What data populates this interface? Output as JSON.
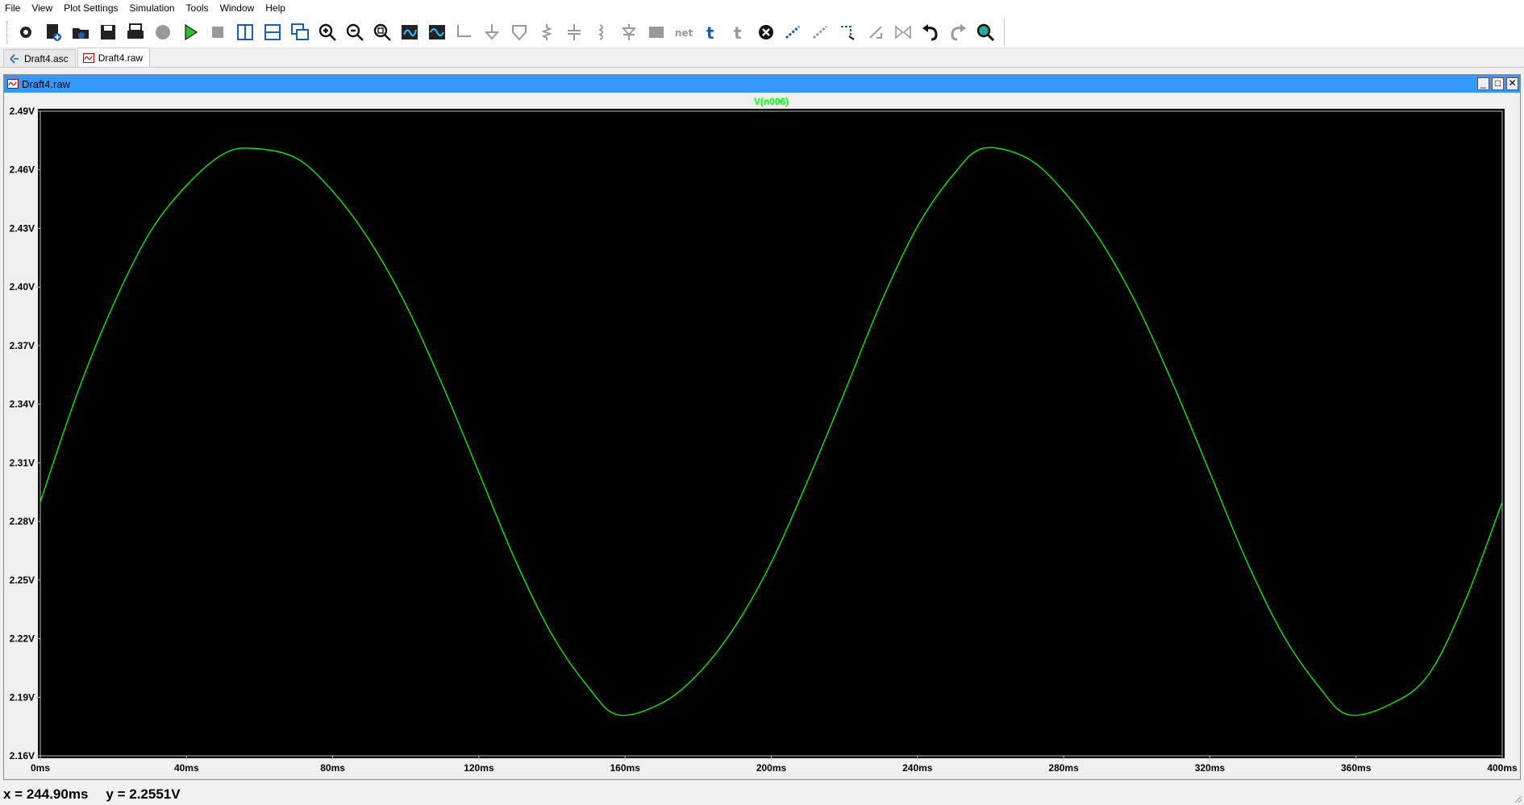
{
  "menu": [
    "File",
    "View",
    "Plot Settings",
    "Simulation",
    "Tools",
    "Window",
    "Help"
  ],
  "toolbar_icons": [
    "control-panel-icon",
    "new-schematic-icon",
    "open-icon",
    "save-icon",
    "print-icon",
    "halt-icon",
    "run-icon",
    "stop-icon",
    "tile-vertical-icon",
    "tile-horizontal-icon",
    "cascade-icon",
    "zoom-in-icon",
    "zoom-out-icon",
    "zoom-fit-icon",
    "autorange-icon",
    "waveform-icon",
    "wire-icon",
    "ground-icon",
    "label-net-icon",
    "resistor-icon",
    "capacitor-icon",
    "inductor-icon",
    "diode-icon",
    "component-icon",
    "net-label-icon",
    "text-icon",
    "spice-directive-icon",
    "delete-icon",
    "duplicate-icon",
    "move-icon",
    "drag-icon",
    "rotate-icon",
    "mirror-icon",
    "undo-icon",
    "redo-icon",
    "find-icon"
  ],
  "tabs": [
    {
      "label": "Draft4.asc",
      "icon": "schematic-icon"
    },
    {
      "label": "Draft4.raw",
      "icon": "waveform-icon"
    }
  ],
  "window": {
    "title": "Draft4.raw",
    "minimize": "_",
    "maximize": "□",
    "close": "✕"
  },
  "status": {
    "x": "x = 244.90ms",
    "y": "y = 2.2551V"
  },
  "colors": {
    "trace": "#00ff00",
    "background": "#000000",
    "axis": "#c0c0c0",
    "tick_label": "#000000",
    "titlebar": "#3399ff"
  },
  "chart_data": {
    "type": "line",
    "title": "V(n006)",
    "xlabel": "",
    "ylabel": "",
    "xlim": [
      0,
      400
    ],
    "ylim": [
      2.16,
      2.49
    ],
    "x_ticks": [
      "0ms",
      "40ms",
      "80ms",
      "120ms",
      "160ms",
      "200ms",
      "240ms",
      "280ms",
      "320ms",
      "360ms",
      "400ms"
    ],
    "y_ticks": [
      "2.49V",
      "2.46V",
      "2.43V",
      "2.40V",
      "2.37V",
      "2.34V",
      "2.31V",
      "2.28V",
      "2.25V",
      "2.22V",
      "2.19V",
      "2.16V"
    ],
    "grid": false,
    "series": [
      {
        "name": "V(n006)",
        "x_unit": "ms",
        "y_unit": "V",
        "x": [
          0,
          10,
          20,
          30,
          40,
          50,
          58,
          70,
          80,
          90,
          100,
          110,
          120,
          130,
          140,
          150,
          158,
          170,
          180,
          190,
          200,
          210,
          220,
          230,
          240,
          250,
          258,
          270,
          280,
          290,
          300,
          310,
          320,
          330,
          340,
          350,
          358,
          370,
          380,
          390,
          400
        ],
        "y": [
          2.29,
          2.345,
          2.391,
          2.428,
          2.452,
          2.468,
          2.471,
          2.466,
          2.449,
          2.424,
          2.391,
          2.35,
          2.305,
          2.26,
          2.222,
          2.195,
          2.181,
          2.187,
          2.202,
          2.226,
          2.259,
          2.301,
          2.346,
          2.392,
          2.431,
          2.458,
          2.471,
          2.466,
          2.449,
          2.424,
          2.391,
          2.35,
          2.305,
          2.26,
          2.222,
          2.195,
          2.181,
          2.187,
          2.202,
          2.24,
          2.29
        ]
      }
    ]
  }
}
